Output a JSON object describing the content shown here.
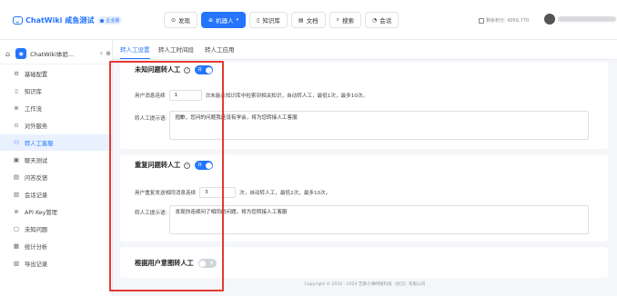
{
  "app": {
    "logo_text": "ChatWiki",
    "logo_sub": "咸鱼测试",
    "badge": "企业版"
  },
  "nav": [
    {
      "label": "发现",
      "icon": "compass-icon",
      "glyph": "⊙",
      "active": false
    },
    {
      "label": "机器人",
      "icon": "robot-icon",
      "glyph": "⊕",
      "active": true
    },
    {
      "label": "知识库",
      "icon": "book-icon",
      "glyph": "▯",
      "active": false
    },
    {
      "label": "文档",
      "icon": "document-icon",
      "glyph": "▤",
      "active": false
    },
    {
      "label": "搜索",
      "icon": "search-icon",
      "glyph": "⌕",
      "active": false
    },
    {
      "label": "会话",
      "icon": "chat-icon",
      "glyph": "◔",
      "active": false
    }
  ],
  "header": {
    "tokens_label": "剩余积分: 4056,770"
  },
  "sidebar": {
    "robot_name": "ChatWiki体验...",
    "items": [
      {
        "label": "基础配置",
        "glyph": "⚙",
        "active": false
      },
      {
        "label": "知识库",
        "glyph": "▯",
        "active": false
      },
      {
        "label": "工作流",
        "glyph": "⊗",
        "active": false
      },
      {
        "label": "对外服务",
        "glyph": "⊙",
        "active": false
      },
      {
        "label": "转人工客服",
        "glyph": "⚇",
        "active": true
      },
      {
        "label": "聊天测试",
        "glyph": "▣",
        "active": false
      },
      {
        "label": "问答反馈",
        "glyph": "▤",
        "active": false
      },
      {
        "label": "会话记录",
        "glyph": "▥",
        "active": false
      },
      {
        "label": "API Key管理",
        "glyph": "⊚",
        "active": false
      },
      {
        "label": "未知问题",
        "glyph": "▢",
        "active": false
      },
      {
        "label": "统计分析",
        "glyph": "▦",
        "active": false
      },
      {
        "label": "导出记录",
        "glyph": "▧",
        "active": false
      }
    ]
  },
  "tabs": [
    {
      "label": "转人工设置",
      "active": true
    },
    {
      "label": "转人工时间段",
      "active": false
    },
    {
      "label": "转人工应用",
      "active": false
    }
  ],
  "sections": {
    "unknown": {
      "title": "未知问题转人工",
      "toggle_label": "开",
      "count_prefix": "用户消息连续",
      "count_value": "1",
      "count_suffix": "次未能从知识库中检索到相关知识，自动转人工，最低1次，最多10次。",
      "prompt_label": "转人工提示语:",
      "prompt_text": "抱歉，您问的问题我还没有学会，将为您转接人工客服"
    },
    "repeat": {
      "title": "重复问题转人工",
      "toggle_label": "开",
      "count_prefix": "用户重复发送相同消息连续",
      "count_value": "3",
      "count_suffix": "次，自动转人工，最低2次，最多10次。",
      "prompt_label": "转人工提示语:",
      "prompt_text": "发现你连续问了相同的问题，将为您转接人工客服"
    },
    "intent": {
      "title": "根据用户意图转人工",
      "toggle_label": "关"
    }
  },
  "footer": "Copyright © 2016 - 2024 芝麻小事网络科技（武汉）有限公司",
  "colors": {
    "accent": "#2475fc",
    "highlight": "#e53935"
  }
}
